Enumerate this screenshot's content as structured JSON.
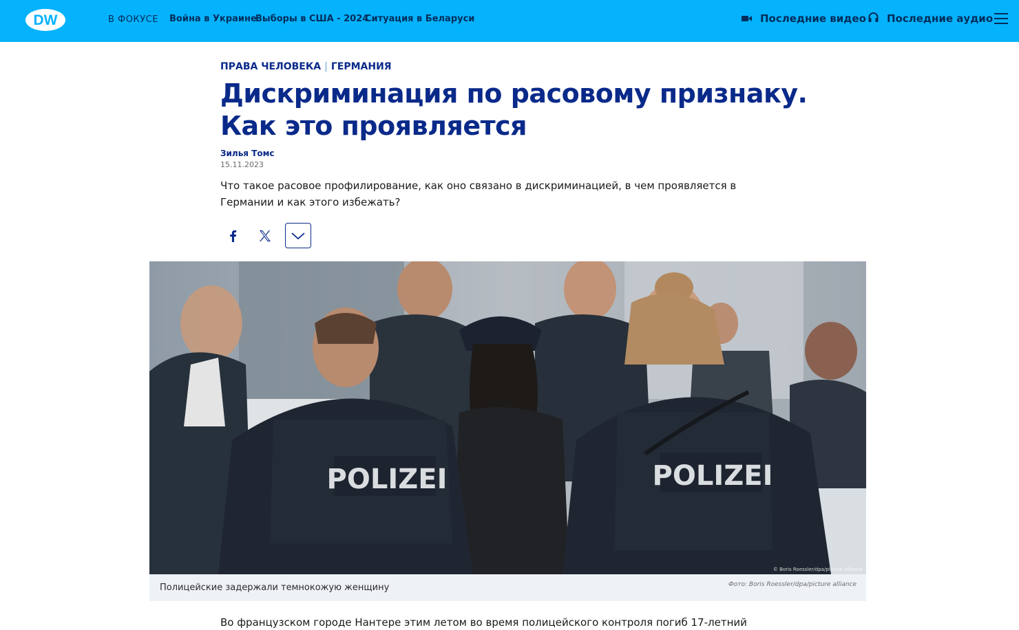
{
  "header": {
    "logo_text": "DW",
    "focus_label": "В ФОКУСЕ",
    "topics": [
      "Война в Украине",
      "Выборы в США - 2024",
      "Ситуация в Беларуси"
    ],
    "latest_video": "Последние видео",
    "latest_audio": "Последние аудио",
    "menu_icon": "hamburger-icon",
    "video_icon": "video-camera-icon",
    "audio_icon": "headphones-icon"
  },
  "article": {
    "kicker": {
      "category": "ПРАВА ЧЕЛОВЕКА",
      "separator": "|",
      "region": "ГЕРМАНИЯ"
    },
    "title": "Дискриминация по расовому признаку. Как это проявляется",
    "author": "Зилья Томс",
    "date": "15.11.2023",
    "lead": "Что такое расовое профилирование, как оно связано в дискриминацией, в чем проявляется в Германии и как этого избежать?",
    "share": {
      "icons": [
        "facebook-icon",
        "x-icon",
        "chevron-down-icon"
      ]
    },
    "image": {
      "vest_label_left": "POLIZEI",
      "vest_label_right": "POLIZEI",
      "watermark": "© Boris Roessler/dpa/picture alliance",
      "caption": "Полицейские задержали темнокожую женщину",
      "credit": "Фото: Boris Roessler/dpa/picture alliance"
    },
    "body_first_line": "Во французском городе Нантере этим летом во время полицейского контроля погиб 17-летний"
  },
  "colors": {
    "header_bg": "#05b2fc",
    "navy": "#0a2a8a",
    "header_text": "#002d5a"
  }
}
